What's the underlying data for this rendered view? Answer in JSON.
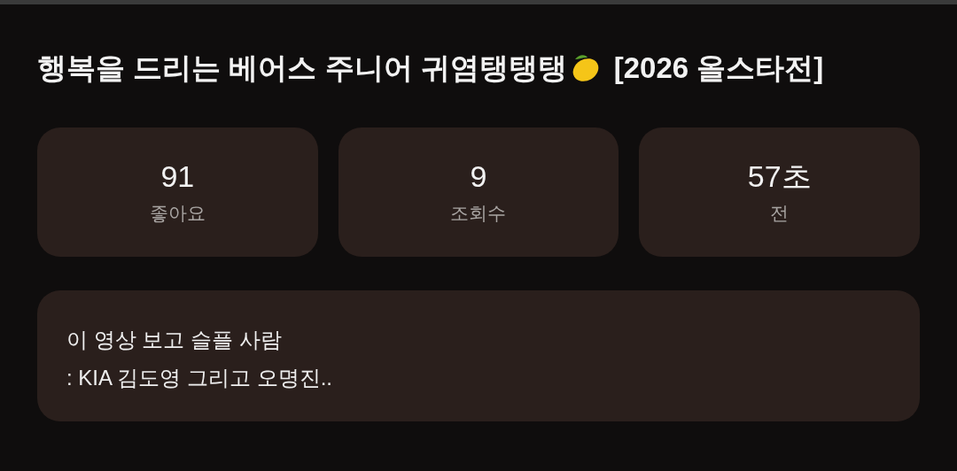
{
  "title": {
    "text": "행복을 드리는 베어스 주니어 귀염탱탱탱",
    "suffix": "[2026 올스타전]"
  },
  "stats": [
    {
      "value": "91",
      "label": "좋아요"
    },
    {
      "value": "9",
      "label": "조회수"
    },
    {
      "value": "57초",
      "label": "전"
    }
  ],
  "description": [
    "이 영상 보고 슬플 사람",
    ": KIA 김도영 그리고 오명진.."
  ]
}
